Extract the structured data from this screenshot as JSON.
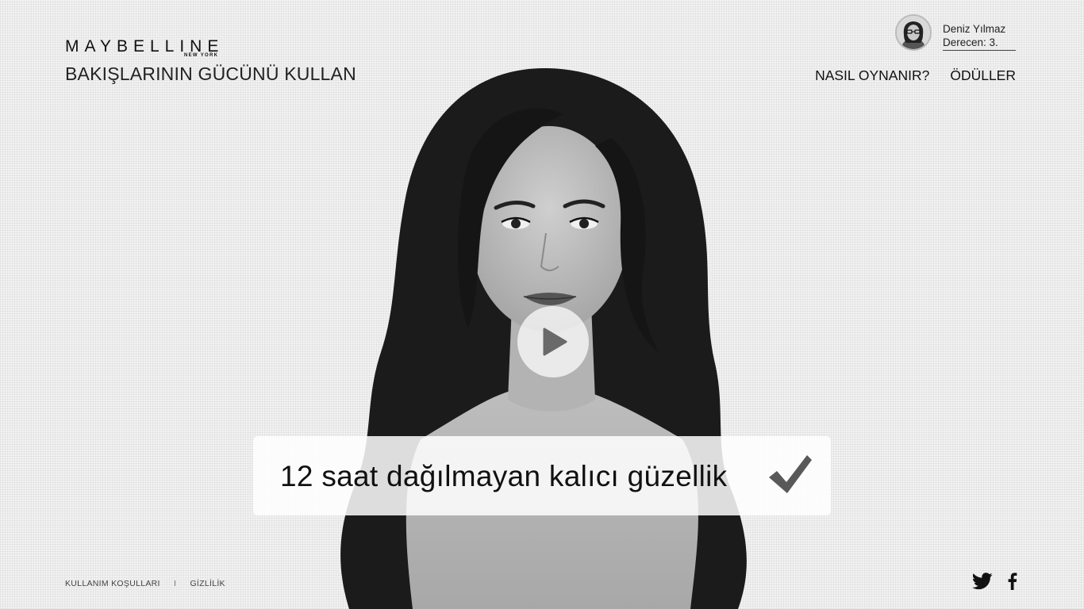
{
  "brand": {
    "logo_text": "MAYBELLINE",
    "logo_subtext": "NEW YORK",
    "tagline": "BAKIŞLARININ GÜCÜNÜ KULLAN"
  },
  "user": {
    "name": "Deniz Yılmaz",
    "rank": "Derecen: 3."
  },
  "nav": {
    "how_to_play": "NASIL OYNANIR?",
    "prizes": "ÖDÜLLER"
  },
  "video": {
    "play_icon": "play-icon"
  },
  "claim": {
    "text": "12 saat dağılmayan kalıcı güzellik",
    "icon": "checkmark-icon"
  },
  "footer": {
    "terms": "KULLANIM KOŞULLARI",
    "separator": "I",
    "privacy": "GİZLİLİK"
  },
  "social": {
    "icons": [
      "twitter-icon",
      "facebook-icon"
    ]
  },
  "colors": {
    "background": "#f2f2f2",
    "text": "#111111"
  }
}
